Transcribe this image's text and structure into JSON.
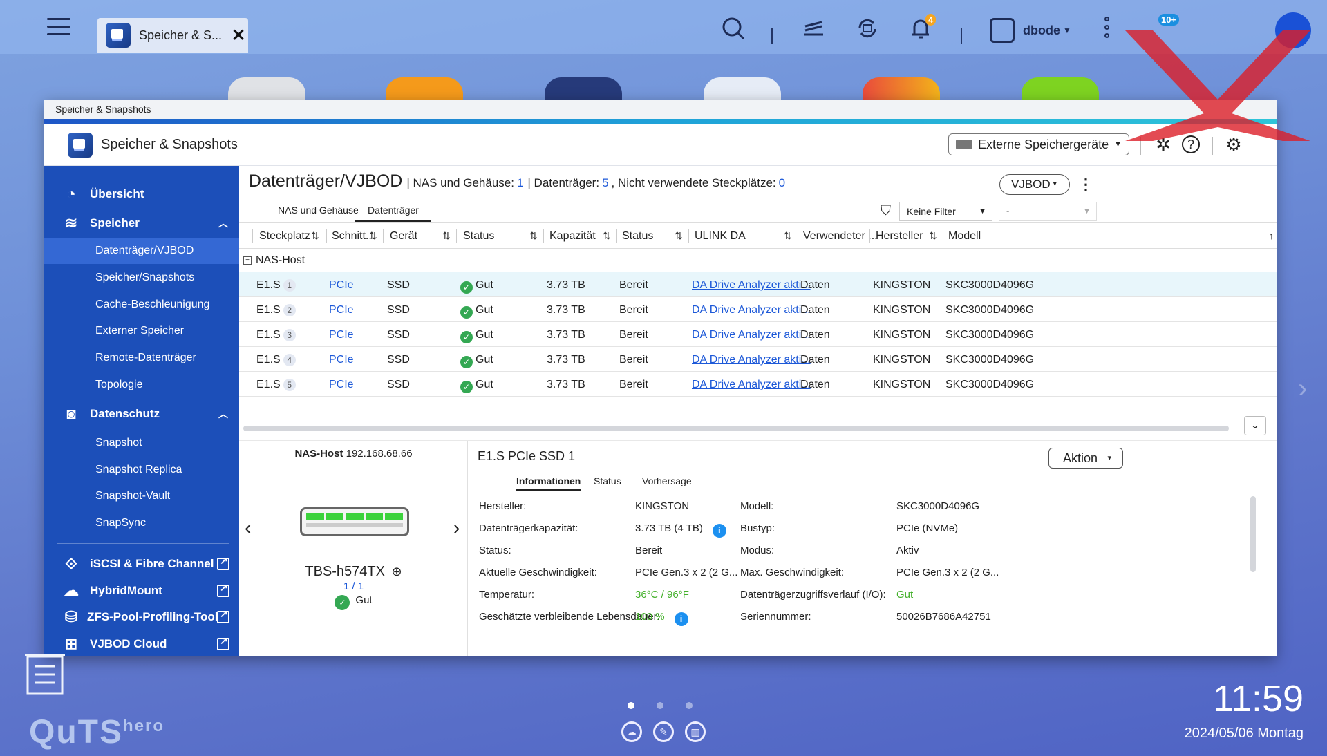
{
  "topbar": {
    "tab_title": "Speicher & S...",
    "notif_count": "4",
    "user": "dbode",
    "badge2": "10+"
  },
  "window": {
    "titlebar": "Speicher & Snapshots",
    "app_title": "Speicher & Snapshots",
    "external_devices": "Externe Speichergeräte"
  },
  "sidebar": {
    "overview": "Übersicht",
    "storage": "Speicher",
    "storage_items": [
      "Datenträger/VJBOD",
      "Speicher/Snapshots",
      "Cache-Beschleunigung",
      "Externer Speicher",
      "Remote-Datenträger",
      "Topologie"
    ],
    "protection": "Datenschutz",
    "protection_items": [
      "Snapshot",
      "Snapshot Replica",
      "Snapshot-Vault",
      "SnapSync"
    ],
    "iscsi": "iSCSI & Fibre Channel",
    "hybridmount": "HybridMount",
    "zfs": "ZFS-Pool-Profiling-Tool",
    "vjbodcloud": "VJBOD Cloud"
  },
  "header": {
    "title": "Datenträger/VJBOD",
    "nas_label": "| NAS und Gehäuse:",
    "nas_val": "1",
    "disk_label": "| Datenträger:",
    "disk_val": "5",
    "free_label": ", Nicht verwendete Steckplätze:",
    "free_val": "0",
    "vjbod": "VJBOD"
  },
  "tabs": [
    "NAS und Gehäuse",
    "Datenträger"
  ],
  "filter": {
    "value": "Keine Filter",
    "second": "-"
  },
  "columns": [
    "Steckplatz",
    "Schnitt...",
    "Gerät",
    "Status",
    "Kapazität",
    "Status",
    "ULINK DA",
    "Verwendeter ...",
    "Hersteller",
    "Modell"
  ],
  "group": "NAS-Host",
  "rows": [
    {
      "slot": "E1.S",
      "n": "1",
      "iface": "PCIe",
      "dev": "SSD",
      "health": "Gut",
      "cap": "3.73 TB",
      "state": "Bereit",
      "ulink": "DA Drive Analyzer akti...",
      "use": "Daten",
      "vendor": "KINGSTON",
      "model": "SKC3000D4096G"
    },
    {
      "slot": "E1.S",
      "n": "2",
      "iface": "PCIe",
      "dev": "SSD",
      "health": "Gut",
      "cap": "3.73 TB",
      "state": "Bereit",
      "ulink": "DA Drive Analyzer akti...",
      "use": "Daten",
      "vendor": "KINGSTON",
      "model": "SKC3000D4096G"
    },
    {
      "slot": "E1.S",
      "n": "3",
      "iface": "PCIe",
      "dev": "SSD",
      "health": "Gut",
      "cap": "3.73 TB",
      "state": "Bereit",
      "ulink": "DA Drive Analyzer akti...",
      "use": "Daten",
      "vendor": "KINGSTON",
      "model": "SKC3000D4096G"
    },
    {
      "slot": "E1.S",
      "n": "4",
      "iface": "PCIe",
      "dev": "SSD",
      "health": "Gut",
      "cap": "3.73 TB",
      "state": "Bereit",
      "ulink": "DA Drive Analyzer akti...",
      "use": "Daten",
      "vendor": "KINGSTON",
      "model": "SKC3000D4096G"
    },
    {
      "slot": "E1.S",
      "n": "5",
      "iface": "PCIe",
      "dev": "SSD",
      "health": "Gut",
      "cap": "3.73 TB",
      "state": "Bereit",
      "ulink": "DA Drive Analyzer akti...",
      "use": "Daten",
      "vendor": "KINGSTON",
      "model": "SKC3000D4096G"
    }
  ],
  "detail": {
    "host_label": "NAS-Host",
    "host_ip": "192.168.68.66",
    "model": "TBS-h574TX",
    "frac": "1 / 1",
    "health": "Gut",
    "title": "E1.S PCIe SSD 1",
    "action": "Aktion",
    "tabs": [
      "Informationen",
      "Status",
      "Vorhersage"
    ],
    "left": [
      {
        "k": "Hersteller:",
        "v": "KINGSTON"
      },
      {
        "k": "Datenträgerkapazität:",
        "v": "3.73 TB (4 TB)"
      },
      {
        "k": "Status:",
        "v": "Bereit"
      },
      {
        "k": "Aktuelle Geschwindigkeit:",
        "v": "PCIe Gen.3 x 2 (2 G..."
      },
      {
        "k": "Temperatur:",
        "v": "36°C / 96°F"
      },
      {
        "k": "Geschätzte verbleibende Lebensdauer:",
        "v": "100 %"
      }
    ],
    "right": [
      {
        "k": "Modell:",
        "v": "SKC3000D4096G"
      },
      {
        "k": "Bustyp:",
        "v": "PCIe (NVMe)"
      },
      {
        "k": "Modus:",
        "v": "Aktiv"
      },
      {
        "k": "Max. Geschwindigkeit:",
        "v": "PCIe Gen.3 x 2 (2 G..."
      },
      {
        "k": "Datenträgerzugriffsverlauf (I/O):",
        "v": "Gut"
      },
      {
        "k": "Seriennummer:",
        "v": "50026B7686A42751"
      }
    ]
  },
  "desktop": {
    "brand": "QuTS",
    "brand_sup": "hero",
    "time": "11:59",
    "date": "2024/05/06 Montag"
  },
  "colors": {
    "sidebar": "#1c4fb9",
    "accent": "#1c58d8",
    "good": "#34a853"
  }
}
